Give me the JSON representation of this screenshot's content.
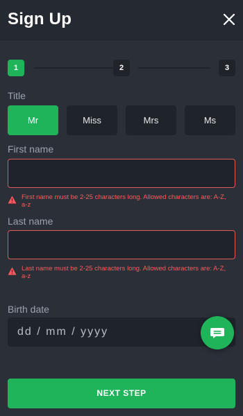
{
  "header": {
    "title": "Sign Up",
    "close_icon": "close-icon"
  },
  "stepper": {
    "steps": [
      "1",
      "2",
      "3"
    ],
    "current_step": 1
  },
  "title_field": {
    "label": "Title",
    "options": [
      "Mr",
      "Miss",
      "Mrs",
      "Ms"
    ],
    "selected": "Mr"
  },
  "first_name": {
    "label": "First name",
    "value": "",
    "error": "First name must be 2-25 characters long. Allowed characters are: A-Z, a-z"
  },
  "last_name": {
    "label": "Last name",
    "value": "",
    "error": "Last name must be 2-25 characters long. Allowed characters are: A-Z, a-z"
  },
  "birth_date": {
    "label": "Birth date",
    "placeholder": "dd / mm / yyyy"
  },
  "chat": {
    "icon": "chat-icon"
  },
  "next_button": {
    "label": "NEXT STEP"
  },
  "colors": {
    "accent": "#1fb35a",
    "background": "#2a2f38",
    "field": "#1f242b",
    "error": "#ff5b5b"
  }
}
